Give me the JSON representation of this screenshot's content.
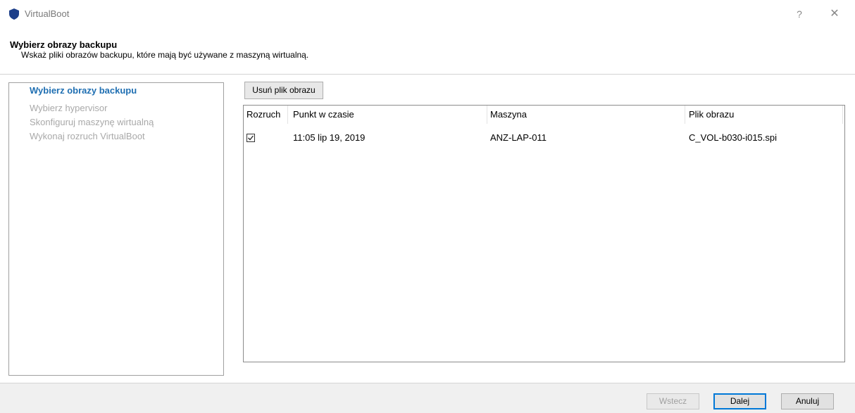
{
  "window": {
    "title": "VirtualBoot",
    "help_label": "?",
    "close_label": "✕"
  },
  "header": {
    "title": "Wybierz obrazy backupu",
    "subtitle": "Wskaż pliki obrazów backupu, które mają być używane z maszyną wirtualną."
  },
  "steps": [
    {
      "label": "Wybierz obrazy backupu",
      "active": true
    },
    {
      "label": "Wybierz hypervisor",
      "active": false
    },
    {
      "label": "Skonfiguruj maszynę wirtualną",
      "active": false
    },
    {
      "label": "Wykonaj rozruch VirtualBoot",
      "active": false
    }
  ],
  "toolbar": {
    "remove_label": "Usuń plik obrazu"
  },
  "table": {
    "columns": [
      "Rozruch",
      "Punkt w czasie",
      "Maszyna",
      "Plik obrazu"
    ],
    "rows": [
      {
        "boot": true,
        "point_in_time": "11:05 lip 19, 2019",
        "machine": "ANZ-LAP-011",
        "image_file": "C_VOL-b030-i015.spi"
      }
    ]
  },
  "footer": {
    "back_label": "Wstecz",
    "next_label": "Dalej",
    "cancel_label": "Anuluj"
  },
  "colors": {
    "accent": "#1f6fb2",
    "shield": "#1d3f8a",
    "default_button_border": "#0078d7"
  }
}
